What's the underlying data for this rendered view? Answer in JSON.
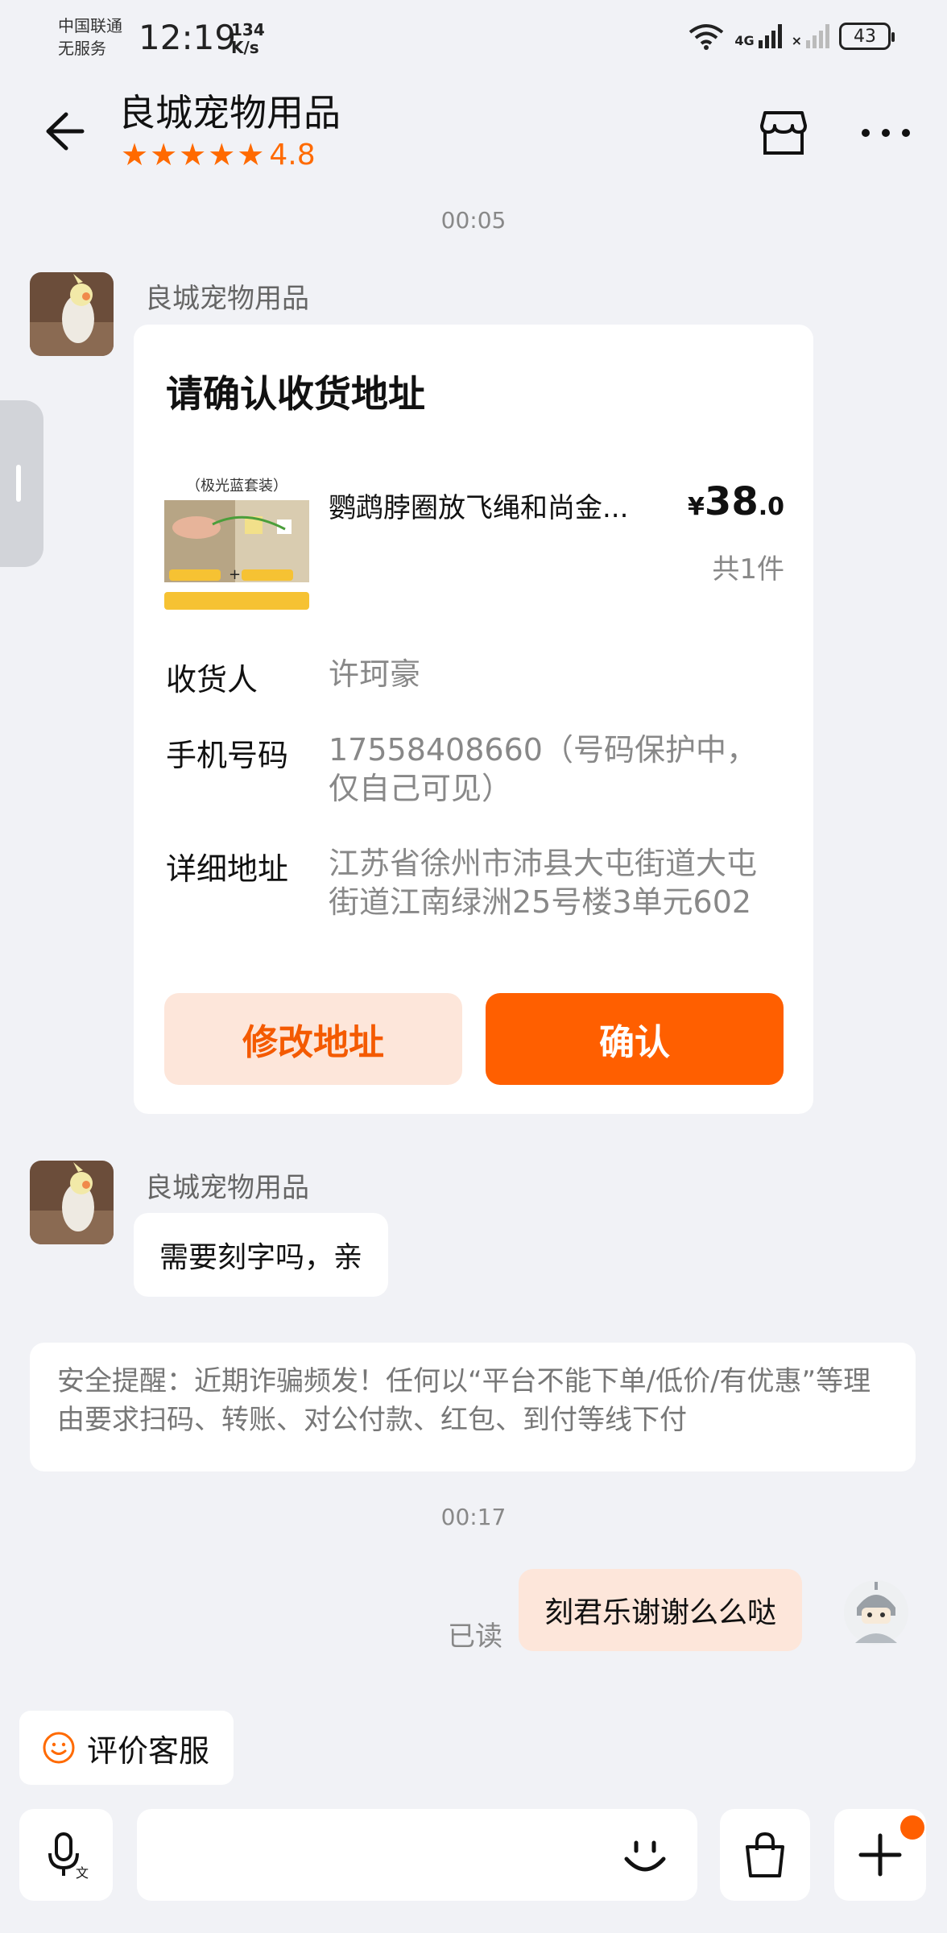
{
  "status_bar": {
    "carrier": "中国联通",
    "service": "无服务",
    "time": "12:19",
    "speed_value": "134",
    "speed_unit": "K/s",
    "network": "4G",
    "battery": "43"
  },
  "header": {
    "title": "良城宠物用品",
    "rating": "4.8",
    "stars": "★★★★★"
  },
  "chat": {
    "timestamp_1": "00:05",
    "sender_1": "良城宠物用品",
    "card": {
      "title": "请确认收货地址",
      "product_tag": "（极光蓝套装）",
      "product_name": "鹦鹉脖圈放飞绳和尚金...",
      "price_currency": "¥",
      "price_int": "38",
      "price_dec": ".0",
      "quantity": "共1件",
      "recipient_label": "收货人",
      "recipient_value": "许珂豪",
      "phone_label": "手机号码",
      "phone_value": "17558408660（号码保护中，仅自己可见）",
      "address_label": "详细地址",
      "address_value": "江苏省徐州市沛县大屯街道大屯街道江南绿洲25号楼3单元602",
      "edit_button": "修改地址",
      "confirm_button": "确认"
    },
    "sender_2": "良城宠物用品",
    "message_2": "需要刻字吗，亲",
    "notice": "安全提醒：近期诈骗频发！任何以“平台不能下单/低价/有优惠”等理由要求扫码、转账、对公付款、红包、到付等线下付",
    "timestamp_2": "00:17",
    "read_status": "已读",
    "my_message": "刻君乐谢谢么么哒"
  },
  "footer": {
    "evaluate_button": "评价客服"
  },
  "icons": {
    "back": "arrow-left-icon",
    "store": "store-icon",
    "more": "more-icon",
    "voice": "voice-translate-icon",
    "emoji": "emoji-icon",
    "bag": "shopping-bag-icon",
    "plus": "plus-icon"
  },
  "colors": {
    "accent": "#ff5f00",
    "accent_soft": "#fde6da",
    "star": "#ff6a00",
    "background": "#f1f2f6"
  }
}
